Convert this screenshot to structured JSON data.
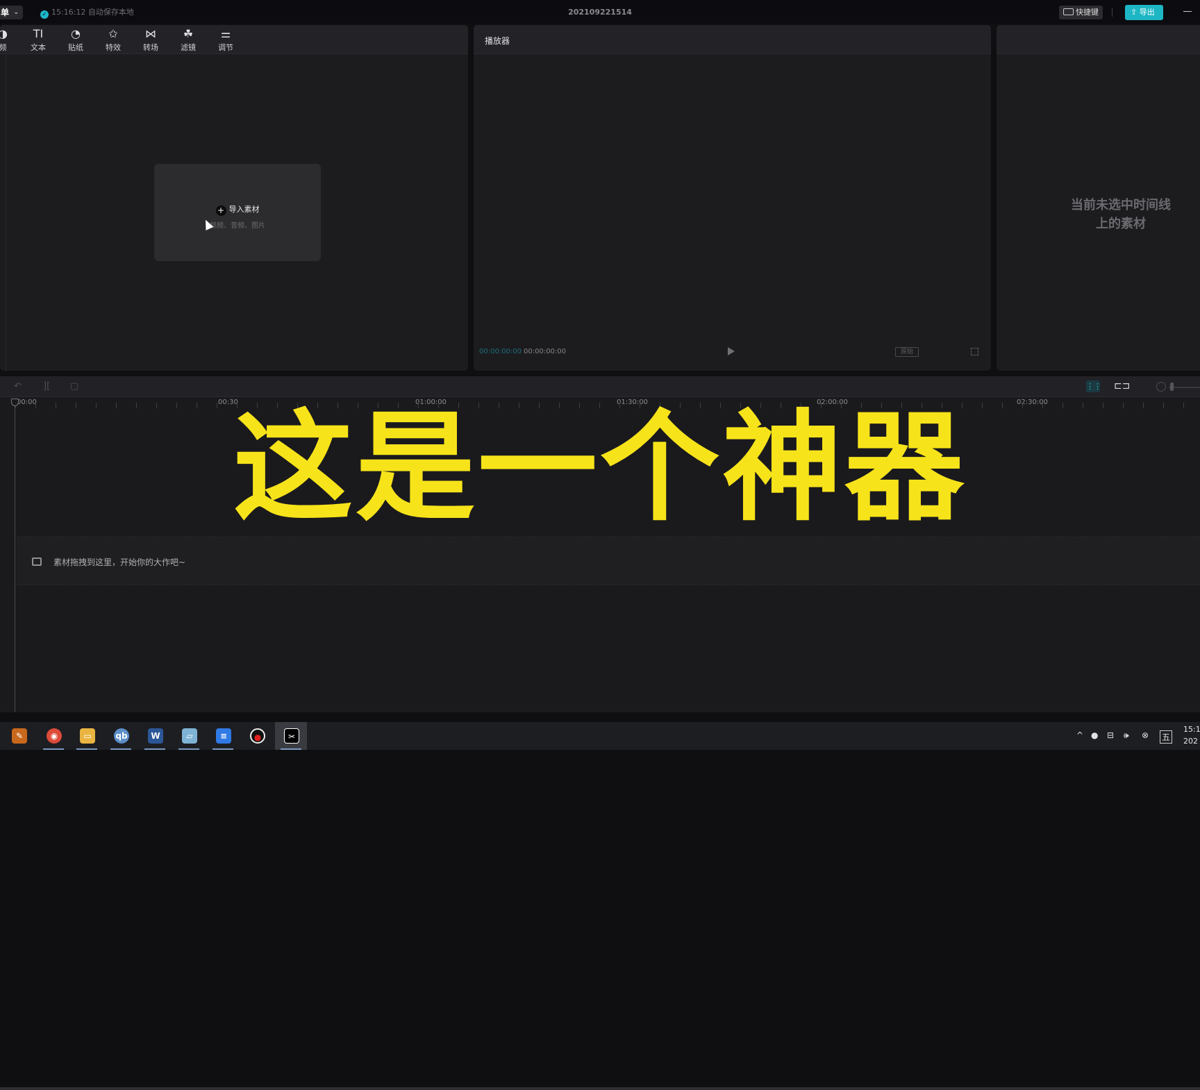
{
  "titlebar": {
    "menu_label": "单",
    "autosave_text": "15:16:12 自动保存本地",
    "project_name": "202109221514",
    "shortcut_label": "快捷键",
    "export_label": "导出"
  },
  "media_toolbar": {
    "tools": [
      {
        "label": "频",
        "icon": "audio-icon"
      },
      {
        "label": "文本",
        "icon": "text-icon"
      },
      {
        "label": "贴纸",
        "icon": "sticker-icon"
      },
      {
        "label": "特效",
        "icon": "effects-icon"
      },
      {
        "label": "转场",
        "icon": "transition-icon"
      },
      {
        "label": "滤镜",
        "icon": "filter-icon"
      },
      {
        "label": "调节",
        "icon": "adjust-icon"
      }
    ]
  },
  "media": {
    "import_label": "导入素材",
    "import_hint": "视频、音频、图片"
  },
  "player": {
    "title": "播放器",
    "current_time": "00:00:00:00",
    "total_time": "00:00:00:00",
    "ratio_label": "原始"
  },
  "attributes": {
    "empty_text": "当前未选中时间线上的素材"
  },
  "timeline": {
    "ruler": [
      "00:00",
      "00:30",
      "01:00:00",
      "01:30:00",
      "02:00:00",
      "02:30:00"
    ],
    "drop_hint": "素材拖拽到这里，开始你的大作吧~",
    "caption": "这是一个神器"
  },
  "taskbar": {
    "clock_time": "15:1",
    "clock_date": "202",
    "ime_label": "五"
  },
  "colors": {
    "accent": "#1db6c4",
    "caption": "#f7e31a",
    "background": "#1c1c1f"
  }
}
